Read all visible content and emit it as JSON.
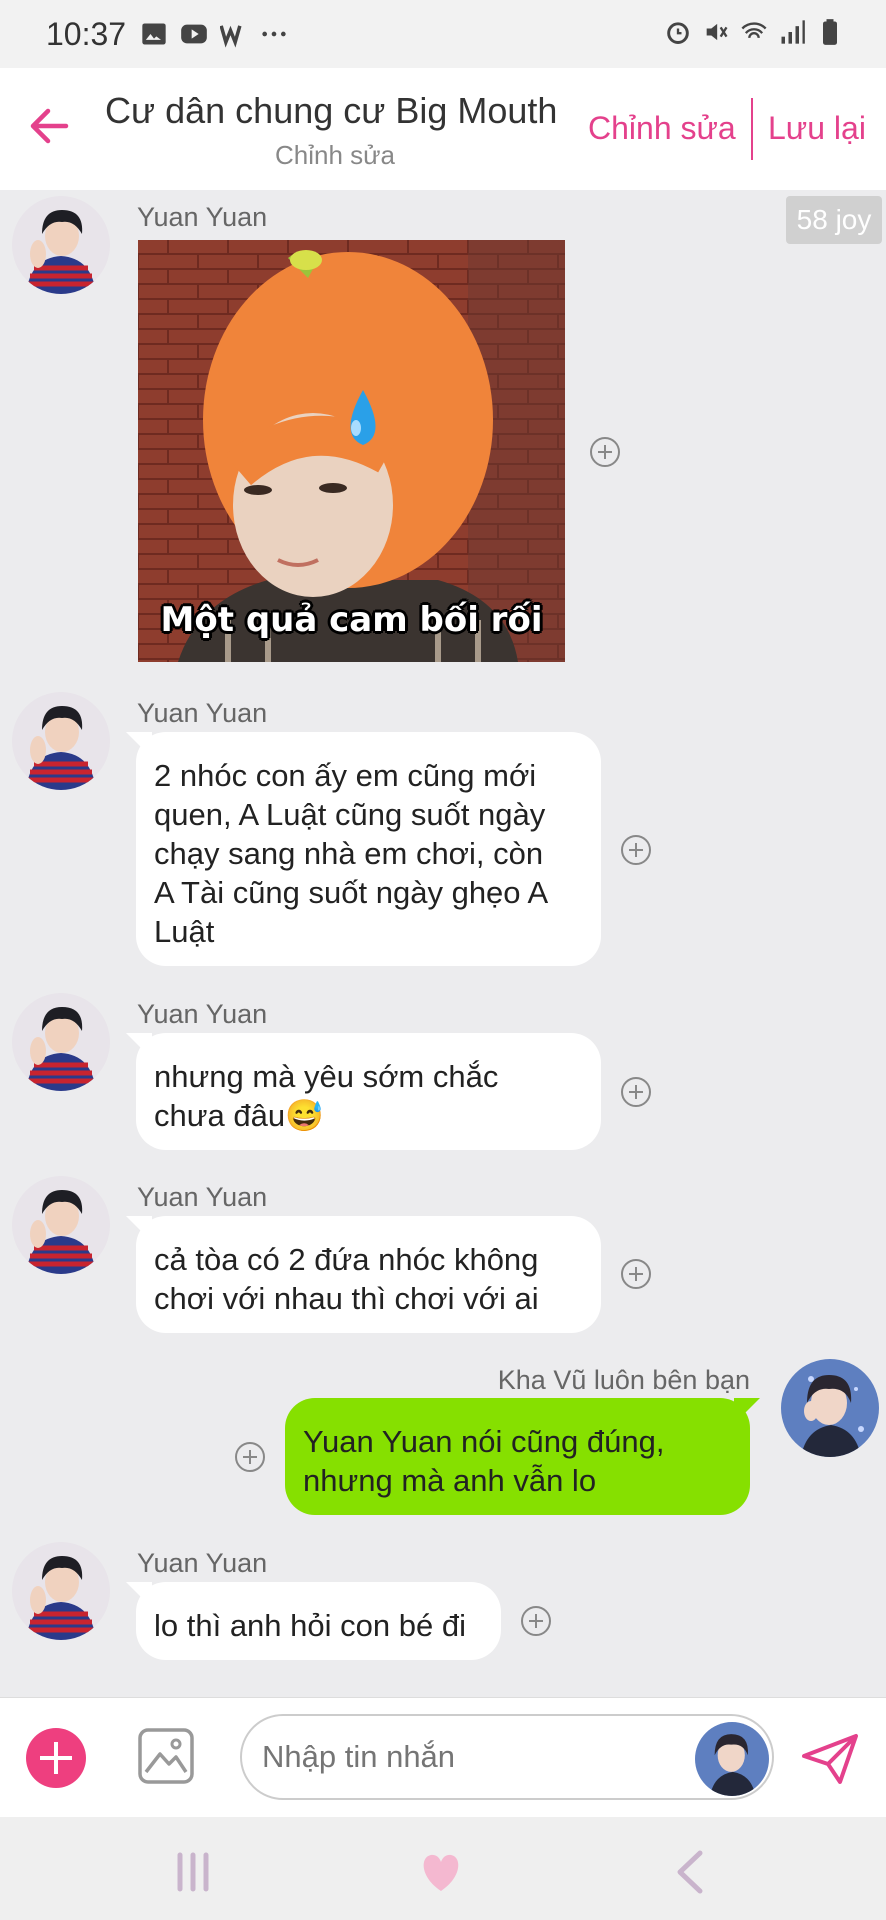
{
  "status_bar": {
    "time": "10:37",
    "left_icons": [
      "gallery-icon",
      "youtube-icon",
      "w-icon",
      "more-dots-icon"
    ],
    "right_icons": [
      "alarm-icon",
      "mute-icon",
      "wifi-icon",
      "signal-icon",
      "battery-icon"
    ]
  },
  "header": {
    "title": "Cư dân chung cư Big Mouth",
    "subtitle": "Chỉnh sửa",
    "edit_label": "Chỉnh sửa",
    "save_label": "Lưu lại",
    "accent_color": "#e4418c"
  },
  "joy_badge": "58 joy",
  "messages": [
    {
      "sender": "Yuan Yuan",
      "type": "image",
      "caption": "Một quả cam bối rối"
    },
    {
      "sender": "Yuan Yuan",
      "type": "text",
      "lines": [
        "2 nhóc con ấy em cũng mới",
        "quen, A Luật cũng suốt ngày",
        "chạy sang nhà em chơi, còn",
        "A Tài cũng suốt ngày ghẹo A",
        "Luật"
      ]
    },
    {
      "sender": "Yuan Yuan",
      "type": "text",
      "lines": [
        "nhưng mà yêu sớm chắc",
        "chưa đâu😅"
      ]
    },
    {
      "sender": "Yuan Yuan",
      "type": "text",
      "lines": [
        "cả tòa có 2 đứa nhóc không",
        "chơi với nhau thì chơi với ai"
      ]
    },
    {
      "sender": "Kha Vũ luôn bên bạn",
      "type": "text",
      "outgoing": true,
      "lines": [
        "Yuan Yuan nói cũng đúng,",
        "nhưng mà anh vẫn lo"
      ]
    },
    {
      "sender": "Yuan Yuan",
      "type": "text",
      "lines": [
        "lo thì anh hỏi con bé đi"
      ]
    }
  ],
  "input_bar": {
    "placeholder": "Nhập tin nhắn",
    "add_color": "#ee3f7f",
    "outgoing_bubble_color": "#86e000"
  },
  "nav_bar": {
    "buttons": [
      "recent-apps-icon",
      "home-heart-icon",
      "back-chevron-icon"
    ]
  }
}
